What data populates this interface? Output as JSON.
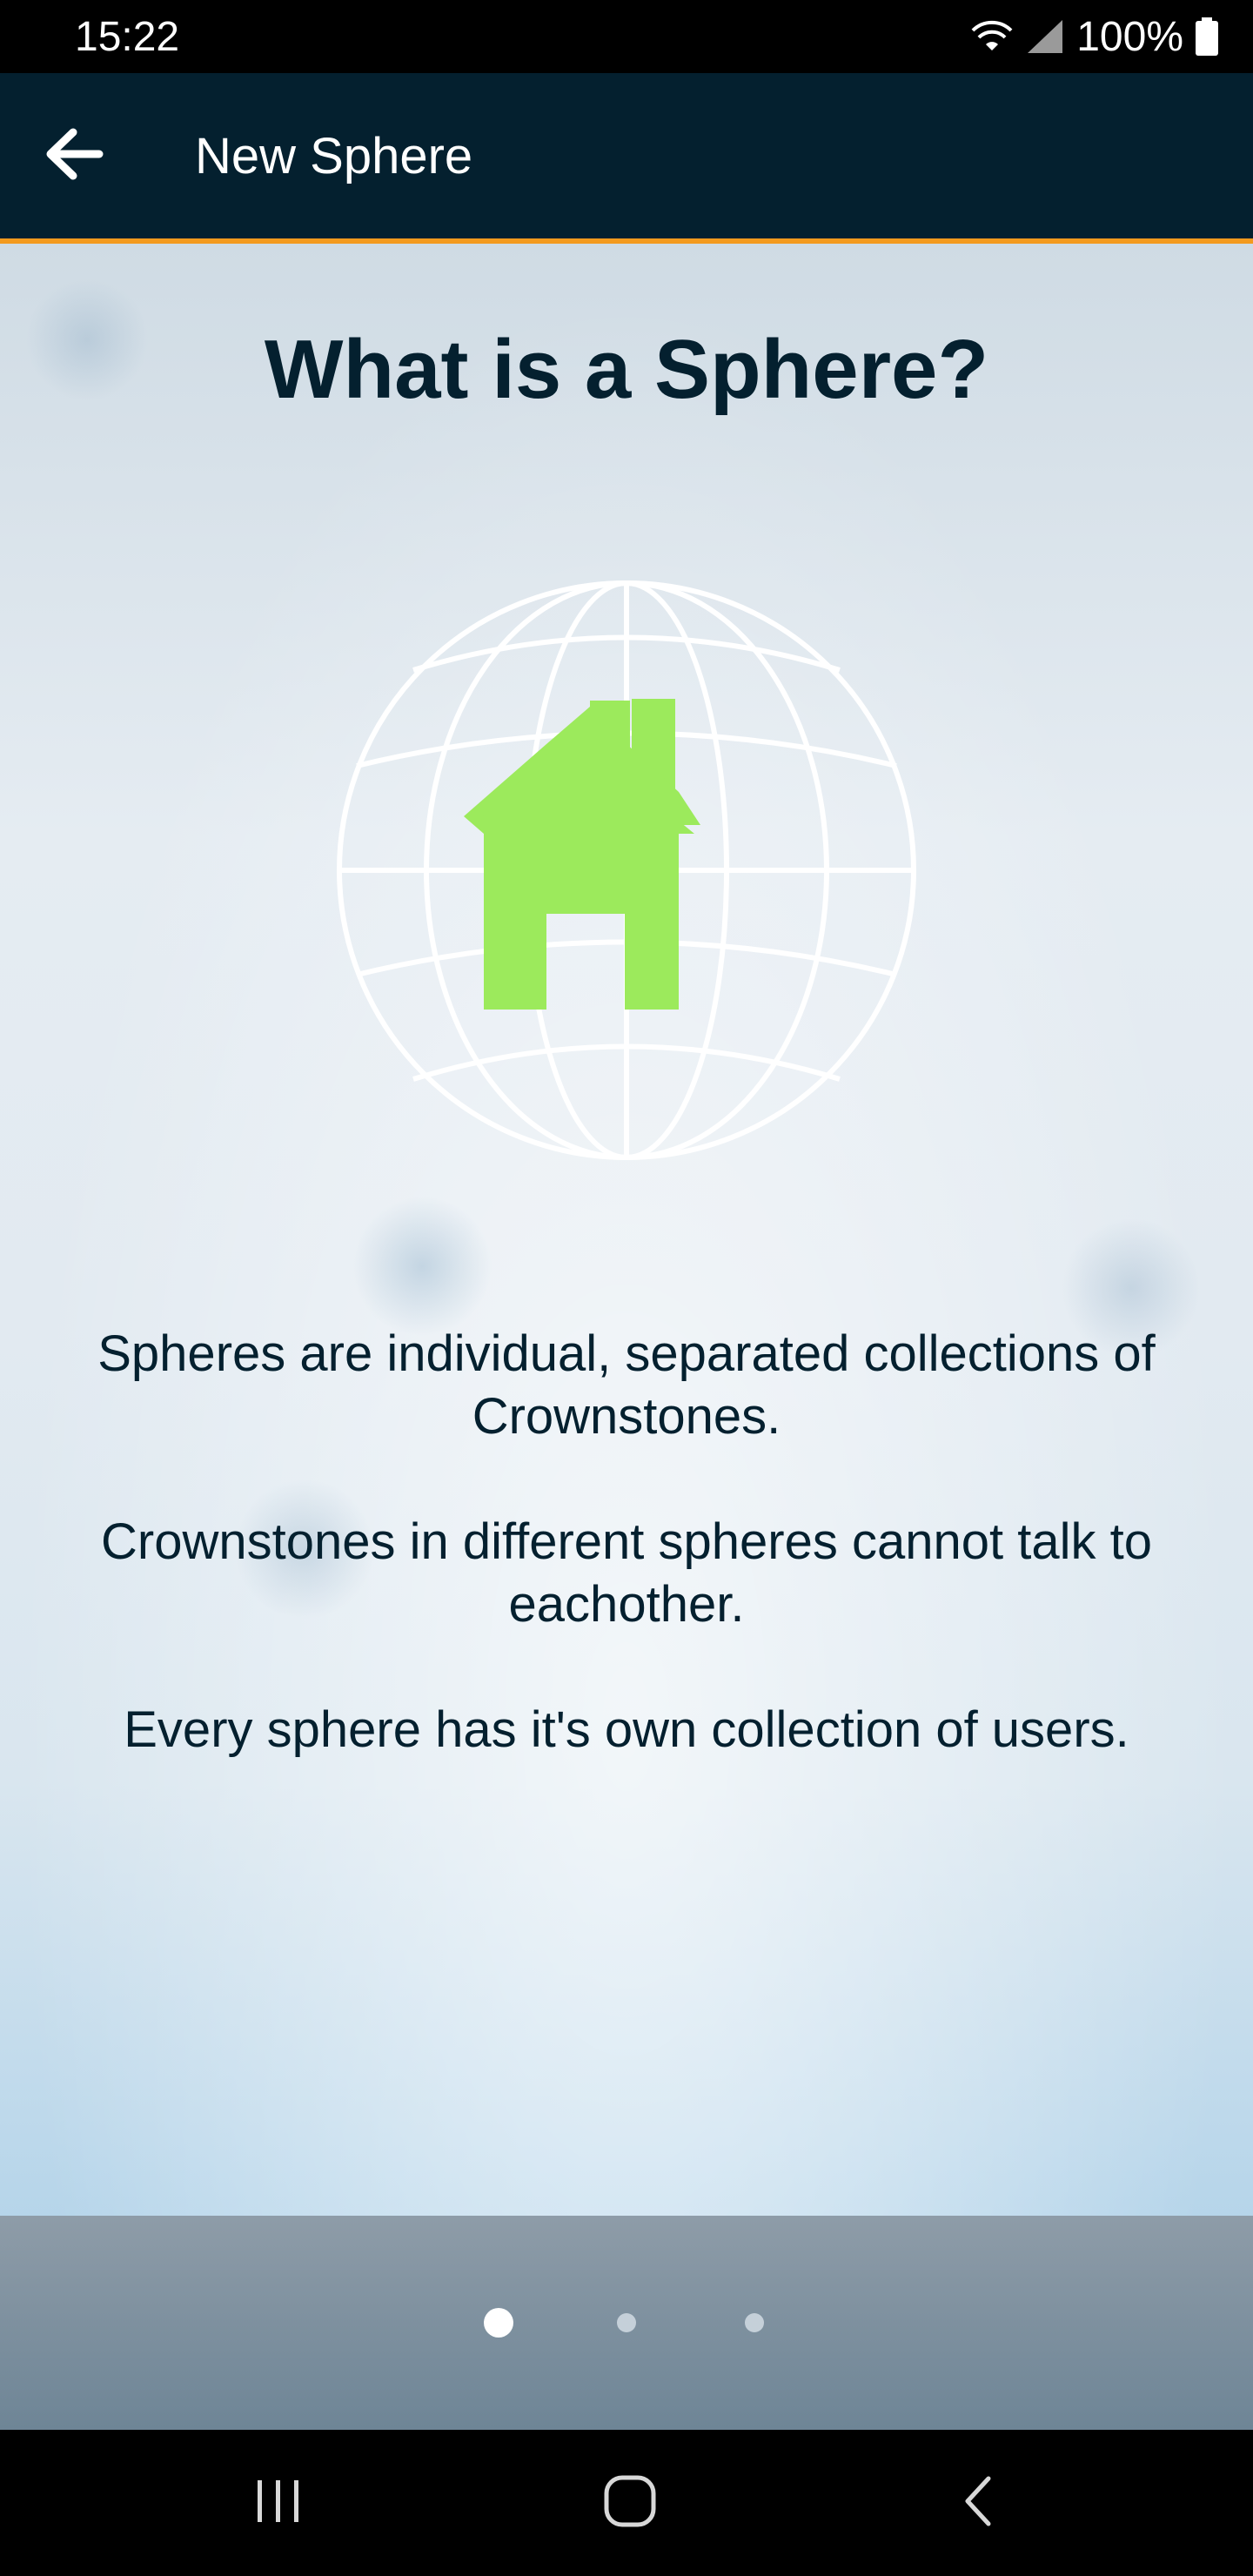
{
  "status_bar": {
    "time": "15:22",
    "battery": "100%",
    "icons": [
      "wifi-icon",
      "signal-icon",
      "battery-icon"
    ]
  },
  "app_bar": {
    "title": "New Sphere",
    "back_icon": "arrow-left-icon"
  },
  "main": {
    "heading": "What is a Sphere?",
    "illustration": "globe-with-house-icon",
    "paragraphs": [
      "Spheres are individual, separated collections of Crownstones.",
      "Crownstones in different spheres cannot talk to eachother.",
      "Every sphere has it's own collection of users."
    ]
  },
  "pager": {
    "page_count": 3,
    "current_page": 1
  },
  "nav_bar": {
    "buttons": [
      "recents-icon",
      "home-icon",
      "back-icon"
    ]
  },
  "colors": {
    "app_bar": "#04202f",
    "accent": "#f39a1e",
    "house": "#9cea5c",
    "heading_text": "#04202f"
  }
}
